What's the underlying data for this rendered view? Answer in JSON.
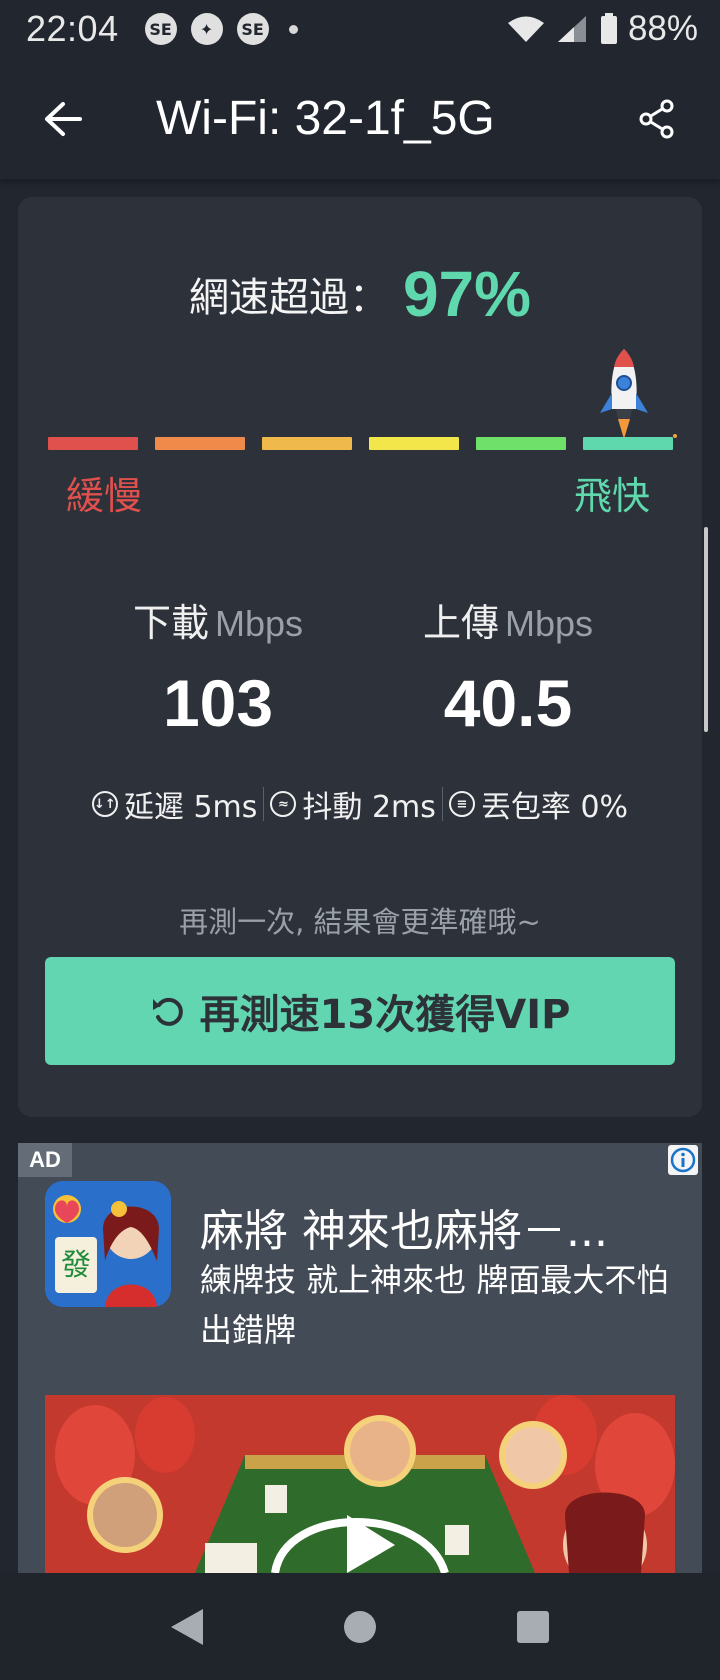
{
  "status_bar": {
    "time": "22:04",
    "notifications": [
      "SE",
      "✦",
      "SE"
    ],
    "battery": "88%"
  },
  "app_bar": {
    "title": "Wi-Fi: 32-1f_5G"
  },
  "result": {
    "beat_label": "網速超過：",
    "beat_value": "97%",
    "scale_slow": "緩慢",
    "scale_fast": "飛快",
    "scale_colors": [
      "#e0504d",
      "#ef8a4a",
      "#f0b94b",
      "#f2e64a",
      "#6fe06a",
      "#5fd8ad"
    ],
    "download": {
      "label": "下載",
      "unit": "Mbps",
      "value": "103"
    },
    "upload": {
      "label": "上傳",
      "unit": "Mbps",
      "value": "40.5"
    },
    "latency": "延遲 5ms",
    "jitter": "抖動 2ms",
    "packet_loss": "丟包率 0%",
    "hint": "再測一次, 結果會更準確哦~",
    "retest_button": "再測速13次獲得VIP"
  },
  "ad": {
    "badge": "AD",
    "title": "麻將 神來也麻將－...",
    "description": "練牌技 就上神來也 牌面最大不怕出錯牌",
    "icon_char": "發"
  },
  "colors": {
    "accent": "#5fd8ad",
    "button": "#62d6b0",
    "background": "#22272f",
    "card": "#2c313a"
  }
}
